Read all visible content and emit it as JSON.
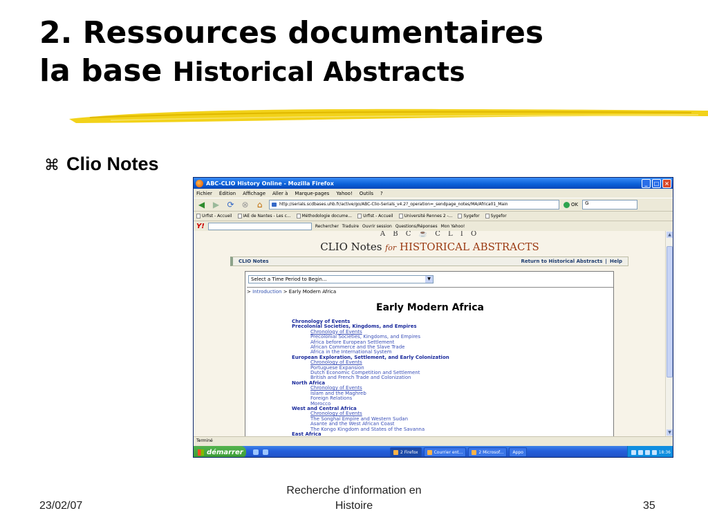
{
  "slide": {
    "title_line1": "2. Ressources documentaires",
    "title_line2_part1": "la base",
    "title_line2_part2": "Historical Abstracts",
    "bullet_icon": "command-key-icon",
    "bullet_text": "Clio Notes",
    "footer_date": "23/02/07",
    "footer_center_line1": "Recherche d'information en",
    "footer_center_line2": "Histoire",
    "footer_page": "35",
    "brush_color": "#f0d000"
  },
  "browser": {
    "window_title": "ABC-CLIO History Online - Mozilla Firefox",
    "menu": [
      "Fichier",
      "Édition",
      "Affichage",
      "Aller à",
      "Marque-pages",
      "Yahoo!",
      "Outils",
      "?"
    ],
    "url": "http://serials.scdbases.uhb.fr/active/go/ABC-Clio-Serials_v4.2?_operation=_sendpage_notes/MA/Africa01_Main",
    "go_label": "OK",
    "search_value": "G",
    "bookmarks": [
      "Urfist - Accueil",
      "IAE de Nantes - Les c...",
      "Méthodologie docume...",
      "Urfist - Accueil",
      "Université Rennes 2 -...",
      "Sygefor",
      "Sygefor"
    ],
    "yahoo_label": "Y!",
    "yahoo_items": [
      "Rechercher",
      "Traduire",
      "Ouvrir session",
      "Questions/Réponses",
      "Mon Yahoo!"
    ],
    "status": "Terminé"
  },
  "page": {
    "abc_logo": "A B C ☕ C L I O",
    "header_main": "CLIO Notes",
    "header_for": "for",
    "header_ha": "HISTORICAL ABSTRACTS",
    "bar_left": "CLIO Notes",
    "bar_link1": "Return to Historical Abstracts",
    "bar_sep": "|",
    "bar_link2": "Help",
    "select_value": "Select a Time Period to Begin...",
    "crumb_prefix": "> ",
    "crumb_link": "Introduction",
    "crumb_rest": " > Early Modern Africa",
    "title": "Early Modern Africa",
    "toc": [
      {
        "kind": "sec",
        "text": "Chronology of Events"
      },
      {
        "kind": "sec",
        "text": "Precolonial Societies, Kingdoms, and Empires"
      },
      {
        "kind": "sub",
        "u": true,
        "text": "Chronology of Events"
      },
      {
        "kind": "sub",
        "text": "Precolonial Societies, Kingdoms, and Empires"
      },
      {
        "kind": "sub",
        "text": "Africa before European Settlement"
      },
      {
        "kind": "sub",
        "text": "African Commerce and the Slave Trade"
      },
      {
        "kind": "sub",
        "text": "Africa in the International System"
      },
      {
        "kind": "sec",
        "text": "European Exploration, Settlement, and Early Colonization"
      },
      {
        "kind": "sub",
        "u": true,
        "text": "Chronology of Events"
      },
      {
        "kind": "sub",
        "text": "Portuguese Expansion"
      },
      {
        "kind": "sub",
        "text": "Dutch Economic Competition and Settlement"
      },
      {
        "kind": "sub",
        "text": "British and French Trade and Colonization"
      },
      {
        "kind": "sec",
        "text": "North Africa"
      },
      {
        "kind": "sub",
        "u": true,
        "text": "Chronology of Events"
      },
      {
        "kind": "sub",
        "text": "Islam and the Maghreb"
      },
      {
        "kind": "sub",
        "text": "Foreign Relations"
      },
      {
        "kind": "sub",
        "text": "Morocco"
      },
      {
        "kind": "sec",
        "text": "West and Central Africa"
      },
      {
        "kind": "sub",
        "u": true,
        "text": "Chronology of Events"
      },
      {
        "kind": "sub",
        "text": "The Songhai Empire and Western Sudan"
      },
      {
        "kind": "sub",
        "text": "Asante and the West African Coast"
      },
      {
        "kind": "sub",
        "text": "The Kongo Kingdom and States of the Savanna"
      },
      {
        "kind": "sec",
        "text": "East Africa"
      }
    ]
  },
  "taskbar": {
    "start_label": "démarrer",
    "items": [
      "2 Firefox",
      "Courrier ent...",
      "2 Microsof...",
      "Appo"
    ],
    "clock": "18:36"
  }
}
